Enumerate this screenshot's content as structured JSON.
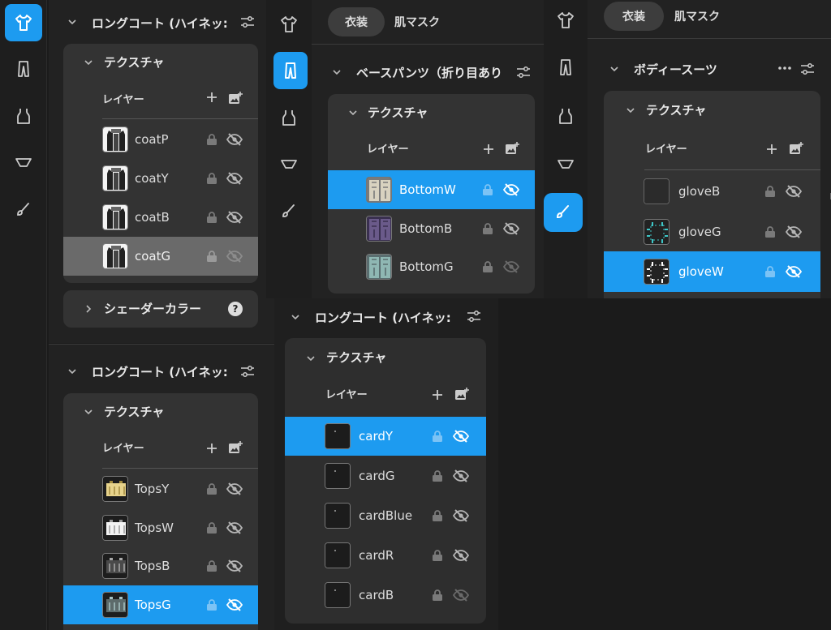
{
  "rail_icons": [
    "shirt-icon",
    "pants-icon",
    "tanktop-icon",
    "underwear-icon",
    "brush-icon"
  ],
  "tabs": {
    "costume": "衣装",
    "skin_mask": "肌マスク"
  },
  "section": {
    "texture": "テクスチャ",
    "layers": "レイヤー",
    "shader_color": "シェーダーカラー"
  },
  "panels": {
    "coat1": {
      "title": "ロングコート (ハイネッ:",
      "layers": [
        "coatP",
        "coatY",
        "coatB",
        "coatG"
      ]
    },
    "pants": {
      "title": "ベースパンツ（折り目あり",
      "layers": [
        "BottomW",
        "BottomB",
        "BottomG"
      ]
    },
    "body": {
      "title": "ボディースーツ",
      "layers": [
        "gloveB",
        "gloveG",
        "gloveW"
      ]
    },
    "coat2": {
      "title": "ロングコート (ハイネッ:",
      "layers": [
        "TopsY",
        "TopsW",
        "TopsB",
        "TopsG"
      ]
    },
    "coat3": {
      "title": "ロングコート (ハイネッ:",
      "layers": [
        "cardY",
        "cardG",
        "cardBlue",
        "cardR",
        "cardB"
      ]
    }
  },
  "colors": {
    "accent": "#1d9bf0",
    "panel": "#222222",
    "card": "#333333",
    "selected_gray": "#6a6a6a"
  }
}
